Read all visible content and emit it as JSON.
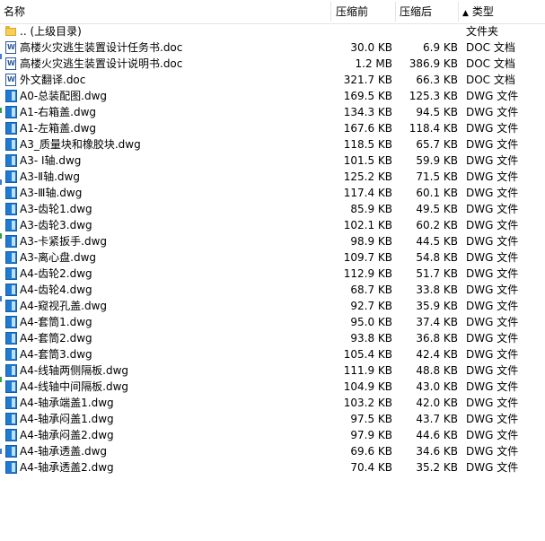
{
  "header": {
    "name_label": "名称",
    "size_label": "压缩前",
    "compressed_label": "压缩后",
    "type_label": "类型",
    "sort_arrow": "▲"
  },
  "files": [
    {
      "icon": "folder-icon",
      "name": ".. (上级目录)",
      "size": "",
      "compressed": "",
      "type": "文件夹"
    },
    {
      "icon": "word-doc-icon",
      "name": "高楼火灾逃生装置设计任务书.doc",
      "size": "30.0 KB",
      "compressed": "6.9 KB",
      "type": "DOC 文档"
    },
    {
      "icon": "word-doc-icon",
      "name": "高楼火灾逃生装置设计说明书.doc",
      "size": "1.2 MB",
      "compressed": "386.9 KB",
      "type": "DOC 文档"
    },
    {
      "icon": "word-doc-icon",
      "name": "外文翻译.doc",
      "size": "321.7 KB",
      "compressed": "66.3 KB",
      "type": "DOC 文档"
    },
    {
      "icon": "dwg-file-icon",
      "name": "A0-总装配图.dwg",
      "size": "169.5 KB",
      "compressed": "125.3 KB",
      "type": "DWG 文件"
    },
    {
      "icon": "dwg-file-icon",
      "name": "A1-右箱盖.dwg",
      "size": "134.3 KB",
      "compressed": "94.5 KB",
      "type": "DWG 文件"
    },
    {
      "icon": "dwg-file-icon",
      "name": "A1-左箱盖.dwg",
      "size": "167.6 KB",
      "compressed": "118.4 KB",
      "type": "DWG 文件"
    },
    {
      "icon": "dwg-file-icon",
      "name": "A3_质量块和橡胶块.dwg",
      "size": "118.5 KB",
      "compressed": "65.7 KB",
      "type": "DWG 文件"
    },
    {
      "icon": "dwg-file-icon",
      "name": "A3- Ⅰ轴.dwg",
      "size": "101.5 KB",
      "compressed": "59.9 KB",
      "type": "DWG 文件"
    },
    {
      "icon": "dwg-file-icon",
      "name": "A3-Ⅱ轴.dwg",
      "size": "125.2 KB",
      "compressed": "71.5 KB",
      "type": "DWG 文件"
    },
    {
      "icon": "dwg-file-icon",
      "name": "A3-Ⅲ轴.dwg",
      "size": "117.4 KB",
      "compressed": "60.1 KB",
      "type": "DWG 文件"
    },
    {
      "icon": "dwg-file-icon",
      "name": "A3-齿轮1.dwg",
      "size": "85.9 KB",
      "compressed": "49.5 KB",
      "type": "DWG 文件"
    },
    {
      "icon": "dwg-file-icon",
      "name": "A3-齿轮3.dwg",
      "size": "102.1 KB",
      "compressed": "60.2 KB",
      "type": "DWG 文件"
    },
    {
      "icon": "dwg-file-icon",
      "name": "A3-卡紧扳手.dwg",
      "size": "98.9 KB",
      "compressed": "44.5 KB",
      "type": "DWG 文件"
    },
    {
      "icon": "dwg-file-icon",
      "name": "A3-离心盘.dwg",
      "size": "109.7 KB",
      "compressed": "54.8 KB",
      "type": "DWG 文件"
    },
    {
      "icon": "dwg-file-icon",
      "name": "A4-齿轮2.dwg",
      "size": "112.9 KB",
      "compressed": "51.7 KB",
      "type": "DWG 文件"
    },
    {
      "icon": "dwg-file-icon",
      "name": "A4-齿轮4.dwg",
      "size": "68.7 KB",
      "compressed": "33.8 KB",
      "type": "DWG 文件"
    },
    {
      "icon": "dwg-file-icon",
      "name": "A4-窥视孔盖.dwg",
      "size": "92.7 KB",
      "compressed": "35.9 KB",
      "type": "DWG 文件"
    },
    {
      "icon": "dwg-file-icon",
      "name": "A4-套筒1.dwg",
      "size": "95.0 KB",
      "compressed": "37.4 KB",
      "type": "DWG 文件"
    },
    {
      "icon": "dwg-file-icon",
      "name": "A4-套筒2.dwg",
      "size": "93.8 KB",
      "compressed": "36.8 KB",
      "type": "DWG 文件"
    },
    {
      "icon": "dwg-file-icon",
      "name": "A4-套筒3.dwg",
      "size": "105.4 KB",
      "compressed": "42.4 KB",
      "type": "DWG 文件"
    },
    {
      "icon": "dwg-file-icon",
      "name": "A4-线轴两侧隔板.dwg",
      "size": "111.9 KB",
      "compressed": "48.8 KB",
      "type": "DWG 文件"
    },
    {
      "icon": "dwg-file-icon",
      "name": "A4-线轴中间隔板.dwg",
      "size": "104.9 KB",
      "compressed": "43.0 KB",
      "type": "DWG 文件"
    },
    {
      "icon": "dwg-file-icon",
      "name": "A4-轴承端盖1.dwg",
      "size": "103.2 KB",
      "compressed": "42.0 KB",
      "type": "DWG 文件"
    },
    {
      "icon": "dwg-file-icon",
      "name": "A4-轴承闷盖1.dwg",
      "size": "97.5 KB",
      "compressed": "43.7 KB",
      "type": "DWG 文件"
    },
    {
      "icon": "dwg-file-icon",
      "name": "A4-轴承闷盖2.dwg",
      "size": "97.9 KB",
      "compressed": "44.6 KB",
      "type": "DWG 文件"
    },
    {
      "icon": "dwg-file-icon",
      "name": "A4-轴承透盖.dwg",
      "size": "69.6 KB",
      "compressed": "34.6 KB",
      "type": "DWG 文件"
    },
    {
      "icon": "dwg-file-icon",
      "name": "A4-轴承透盖2.dwg",
      "size": "70.4 KB",
      "compressed": "35.2 KB",
      "type": "DWG 文件"
    }
  ]
}
